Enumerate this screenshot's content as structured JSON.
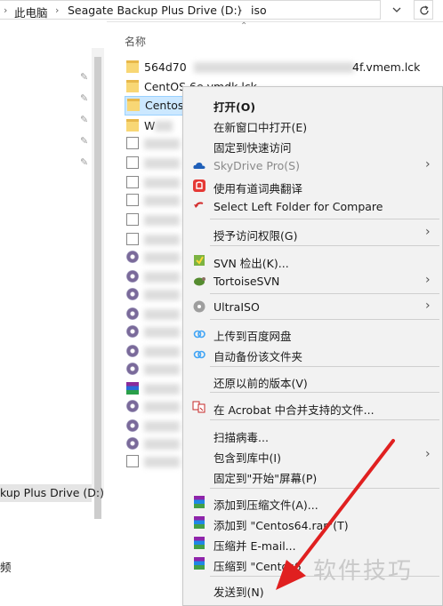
{
  "breadcrumb": {
    "items": [
      "此电脑",
      "Seagate Backup Plus Drive (D:)",
      "iso"
    ]
  },
  "nav": {
    "items": [
      {
        "label": "kup Plus Drive (D:)",
        "selected": true
      },
      {
        "label": "频",
        "selected": false
      }
    ]
  },
  "file_list": {
    "column_name": "名称",
    "files": [
      {
        "name": "564d70",
        "name_tail": "4f.vmem.lck",
        "type": "folder",
        "selected": false
      },
      {
        "name": "CentOS 6e.vmdk.lck",
        "type": "folder",
        "selected": false
      },
      {
        "name": "Centos6",
        "type": "folder",
        "selected": true
      },
      {
        "name": "W",
        "name_tail": "vl",
        "type": "folder",
        "selected": false
      }
    ]
  },
  "context_menu": {
    "items": [
      {
        "label": "打开(O)",
        "bold": true,
        "icon": "none"
      },
      {
        "label": "在新窗口中打开(E)",
        "icon": "none"
      },
      {
        "label": "固定到快速访问",
        "icon": "none"
      },
      {
        "label": "SkyDrive Pro(S)",
        "icon": "cloud-icon",
        "disabled": true,
        "submenu": true
      },
      {
        "label": "使用有道词典翻译",
        "icon": "youdao-icon"
      },
      {
        "label": "Select Left Folder for Compare",
        "icon": "compare-icon"
      },
      {
        "label": "授予访问权限(G)",
        "icon": "none",
        "submenu": true
      },
      {
        "label": "SVN 检出(K)...",
        "icon": "svn-checkout-icon"
      },
      {
        "label": "TortoiseSVN",
        "icon": "tortoise-icon",
        "submenu": true
      },
      {
        "label": "UltraISO",
        "icon": "ultraiso-icon",
        "submenu": true
      },
      {
        "label": "上传到百度网盘",
        "icon": "baidu-cloud-icon"
      },
      {
        "label": "自动备份该文件夹",
        "icon": "baidu-backup-icon"
      },
      {
        "label": "还原以前的版本(V)",
        "icon": "none"
      },
      {
        "label": "在 Acrobat 中合并支持的文件...",
        "icon": "acrobat-icon"
      },
      {
        "label": "扫描病毒...",
        "icon": "none"
      },
      {
        "label": "包含到库中(I)",
        "icon": "none",
        "submenu": true
      },
      {
        "label": "固定到\"开始\"屏幕(P)",
        "icon": "none"
      },
      {
        "label": "添加到压缩文件(A)...",
        "icon": "winrar-icon"
      },
      {
        "label": "添加到 \"Centos64.rar\"(T)",
        "icon": "winrar-icon"
      },
      {
        "label": "压缩并 E-mail...",
        "icon": "winrar-icon"
      },
      {
        "label": "压缩到 \"Centos6",
        "icon": "winrar-icon"
      },
      {
        "label": "发送到(N)",
        "icon": "none"
      }
    ]
  },
  "watermark": "软件技巧",
  "colors": {
    "selection_bg": "#cce8ff",
    "menu_bg": "#f2f2f2",
    "annotation_red": "#e02020"
  }
}
